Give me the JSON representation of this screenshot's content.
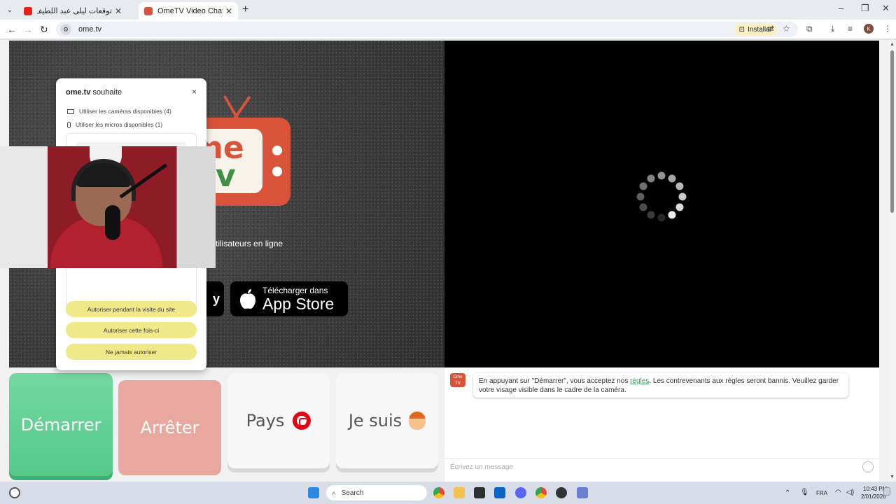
{
  "browser": {
    "tabs": [
      {
        "title": "توقعات ليلى عبد اللطيف لتونس",
        "favicon_color": "#e62117",
        "active": false
      },
      {
        "title": "OmeTV Video Chat — Omegle",
        "favicon_color": "#d9533a",
        "active": true
      }
    ],
    "new_tab": "+",
    "url": "ome.tv",
    "install_label": "Installer",
    "profile_initial": "K"
  },
  "logo": {
    "line1": "me",
    "line2": "tv"
  },
  "online_users_text": "tilisateurs en ligne",
  "store": {
    "gplay_partial": "y",
    "apple_small": "Télécharger dans",
    "apple_big": "App Store"
  },
  "permission_popup": {
    "site": "ome.tv",
    "title_suffix": "souhaite",
    "close": "×",
    "camera_text": "Utiliser les caméras disponibles (4)",
    "mic_text": "Utiliser les micros disponibles (1)",
    "buttons": [
      "Autoriser pendant la visite du site",
      "Autoriser cette fois-ci",
      "Ne jamais autoriser"
    ]
  },
  "controls": {
    "start": "Démarrer",
    "stop": "Arrêter",
    "country": "Pays",
    "gender": "Je suis"
  },
  "chat": {
    "avatar_text": "Ome TV",
    "message_before": "En appuyant sur \"Démarrer\", vous acceptez nos ",
    "message_link": "règles",
    "message_after": ". Les contrevenants aux règles seront bannis. Veuillez garder votre visage visible dans le cadre de la caméra.",
    "input_placeholder": "Écrivez un message"
  },
  "taskbar": {
    "search_placeholder": "Search",
    "lang": "FRA",
    "time": "10:43 PM",
    "date": "2/01/2026"
  },
  "colors": {
    "start": "#55c98a",
    "stop": "#e8a89f",
    "brand": "#d9533a",
    "permission_button": "#f1e88a"
  }
}
